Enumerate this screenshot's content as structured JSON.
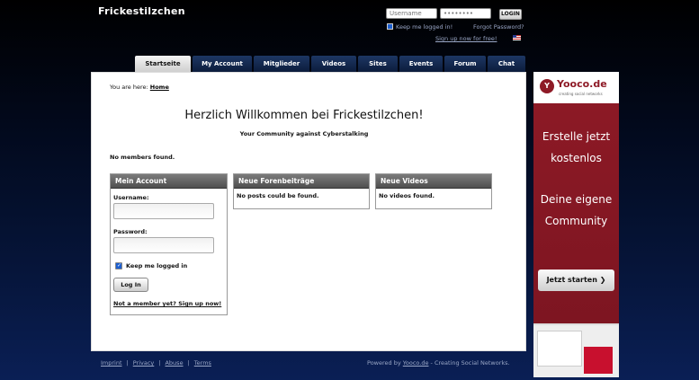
{
  "header": {
    "site_title": "Frickestilzchen",
    "username_placeholder": "Username",
    "password_placeholder": "••••••••",
    "login_label": "LOGIN",
    "keep_logged_in": "Keep me logged in!",
    "forgot_password": "Forgot Password?",
    "signup": "Sign up now for free!"
  },
  "nav": {
    "tabs": [
      {
        "label": "Startseite"
      },
      {
        "label": "My Account"
      },
      {
        "label": "Mitglieder"
      },
      {
        "label": "Videos"
      },
      {
        "label": "Sites"
      },
      {
        "label": "Events"
      },
      {
        "label": "Forum"
      },
      {
        "label": "Chat"
      }
    ]
  },
  "main": {
    "breadcrumb_prefix": "You are here:",
    "breadcrumb_home": "Home",
    "welcome": "Herzlich Willkommen bei Frickestilzchen!",
    "subtitle": "Your Community against Cyberstalking",
    "no_members": "No members found."
  },
  "account_box": {
    "title": "Mein Account",
    "username_label": "Username:",
    "password_label": "Password:",
    "keep_logged_in": "Keep me logged in",
    "login_button": "Log In",
    "not_member": "Not a member yet? Sign up now!"
  },
  "forum_box": {
    "title": "Neue Forenbeiträge",
    "message": "No posts could be found."
  },
  "videos_box": {
    "title": "Neue Videos",
    "message": "No videos found."
  },
  "footer": {
    "links": [
      "Imprint",
      "Privacy",
      "Abuse",
      "Terms"
    ],
    "powered_prefix": "Powered by",
    "powered_link": "Yooco.de",
    "powered_suffix": "- Creating Social Networks."
  },
  "ad": {
    "logo": "Yooco.de",
    "tagline": "creating social networks",
    "line1a": "Erstelle jetzt",
    "line1b": "kostenlos",
    "line2a": "Deine eigene",
    "line2b": "Community",
    "cta": "Jetzt starten ❯"
  }
}
